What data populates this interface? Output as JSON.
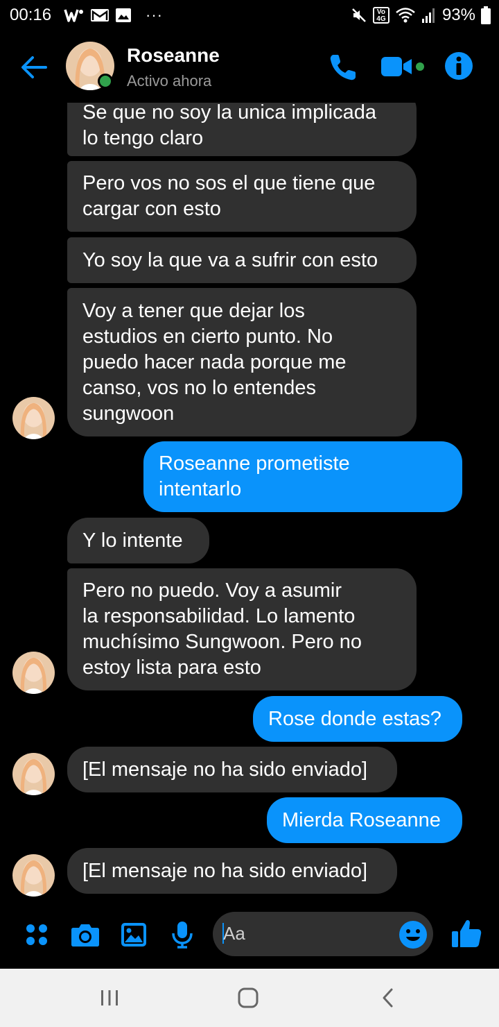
{
  "status_bar": {
    "time": "00:16",
    "battery": "93%",
    "network": "4G",
    "more": "···"
  },
  "header": {
    "name": "Roseanne",
    "status": "Activo ahora",
    "accent_color": "#0a93fb",
    "online_color": "#31a24c"
  },
  "messages": [
    {
      "side": "in",
      "text": "Se que no soy la unica implicada\nlo tengo claro"
    },
    {
      "side": "in",
      "text": "Pero vos no sos el que tiene que\ncargar con esto"
    },
    {
      "side": "in",
      "text": "Yo soy la que va a sufrir con esto"
    },
    {
      "side": "in",
      "text": "Voy a tener que dejar los\nestudios en cierto punto. No\npuedo hacer nada porque me\ncanso, vos no lo entendes\nsungwoon"
    },
    {
      "side": "out",
      "text": "Roseanne prometiste\nintentarlo"
    },
    {
      "side": "in",
      "text": "Y lo intente"
    },
    {
      "side": "in",
      "text": "Pero no puedo. Voy a asumir\nla responsabilidad. Lo lamento\nmuchísimo Sungwoon. Pero no\nestoy lista para esto"
    },
    {
      "side": "out",
      "text": "Rose donde estas?"
    },
    {
      "side": "in",
      "text": "[El mensaje no ha sido enviado]"
    },
    {
      "side": "out",
      "text": "Mierda Roseanne"
    },
    {
      "side": "in",
      "text": "[El mensaje no ha sido enviado]"
    }
  ],
  "composer": {
    "placeholder": "Aa",
    "icons": [
      "apps-icon",
      "camera-icon",
      "gallery-icon",
      "microphone-icon",
      "emoji-icon",
      "like-icon"
    ]
  },
  "navbar": {
    "icons": [
      "recent-apps-icon",
      "home-icon",
      "back-icon"
    ]
  }
}
